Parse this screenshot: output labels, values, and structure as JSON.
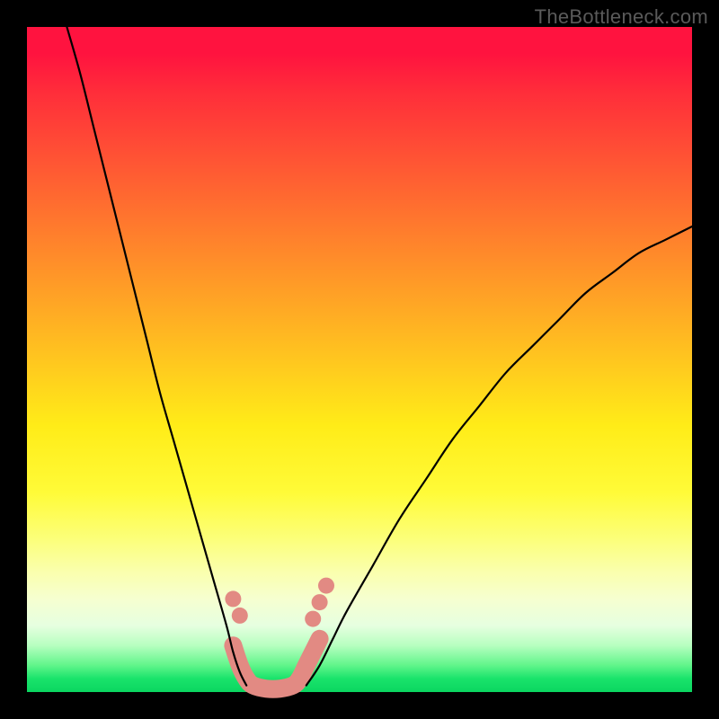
{
  "watermark": "TheBottleneck.com",
  "chart_data": {
    "type": "line",
    "title": "",
    "xlabel": "",
    "ylabel": "",
    "xlim": [
      0,
      100
    ],
    "ylim": [
      0,
      100
    ],
    "background_gradient": {
      "top_color": "#ff133f",
      "mid_color": "#ffec18",
      "bottom_color": "#0bd660"
    },
    "series": [
      {
        "name": "left-curve",
        "stroke": "#000000",
        "x": [
          6,
          8,
          10,
          12,
          14,
          16,
          18,
          20,
          22,
          24,
          26,
          28,
          30,
          31,
          32,
          33
        ],
        "y": [
          100,
          93,
          85,
          77,
          69,
          61,
          53,
          45,
          38,
          31,
          24,
          17,
          10,
          6,
          3,
          1
        ]
      },
      {
        "name": "right-curve",
        "stroke": "#000000",
        "x": [
          42,
          44,
          46,
          48,
          52,
          56,
          60,
          64,
          68,
          72,
          76,
          80,
          84,
          88,
          92,
          96,
          100
        ],
        "y": [
          1,
          4,
          8,
          12,
          19,
          26,
          32,
          38,
          43,
          48,
          52,
          56,
          60,
          63,
          66,
          68,
          70
        ]
      },
      {
        "name": "valley-floor",
        "stroke": "#e28a83",
        "x": [
          31,
          32,
          33,
          34,
          36,
          38,
          40,
          41,
          42,
          43,
          44
        ],
        "y": [
          7,
          4,
          2,
          1,
          0.5,
          0.5,
          1,
          2,
          4,
          6,
          8
        ]
      }
    ],
    "dot_markers": {
      "color": "#e28a83",
      "radius_px": 9,
      "points": [
        {
          "x": 31.0,
          "y": 14.0
        },
        {
          "x": 32.0,
          "y": 11.5
        },
        {
          "x": 43.0,
          "y": 11.0
        },
        {
          "x": 44.0,
          "y": 13.5
        },
        {
          "x": 45.0,
          "y": 16.0
        }
      ]
    }
  }
}
